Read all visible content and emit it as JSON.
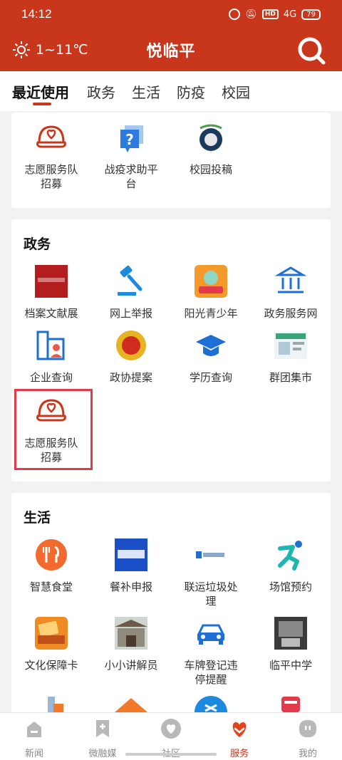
{
  "status_bar": {
    "time": "14:12",
    "network": "4G",
    "hd": "HD",
    "battery": "79"
  },
  "header": {
    "weather": "1~11℃",
    "title": "悦临平"
  },
  "tabs": [
    "最近使用",
    "政务",
    "生活",
    "防疫",
    "校园"
  ],
  "recent": {
    "items": [
      {
        "label": "志愿服务队招募",
        "icon": "volunteer-cap-icon"
      },
      {
        "label": "战疫求助平台",
        "icon": "help-question-icon"
      },
      {
        "label": "校园投稿",
        "icon": "campus-logo-icon"
      }
    ]
  },
  "government": {
    "title": "政务",
    "items": [
      {
        "label": "档案文献展",
        "icon": "archive-exhibit-icon"
      },
      {
        "label": "网上举报",
        "icon": "gavel-icon"
      },
      {
        "label": "阳光青少年",
        "icon": "youth-icon"
      },
      {
        "label": "政务服务网",
        "icon": "building-icon"
      },
      {
        "label": "企业查询",
        "icon": "enterprise-search-icon"
      },
      {
        "label": "政协提案",
        "icon": "emblem-icon"
      },
      {
        "label": "学历查询",
        "icon": "graduation-cap-icon"
      },
      {
        "label": "群团集市",
        "icon": "market-icon"
      },
      {
        "label": "志愿服务队招募",
        "icon": "volunteer-cap-icon"
      }
    ]
  },
  "life": {
    "title": "生活",
    "items": [
      {
        "label": "智慧食堂",
        "icon": "canteen-icon"
      },
      {
        "label": "餐补申报",
        "icon": "meal-subsidy-icon"
      },
      {
        "label": "联运垃圾处理",
        "icon": "garbage-icon"
      },
      {
        "label": "场馆预约",
        "icon": "runner-icon"
      },
      {
        "label": "文化保障卡",
        "icon": "culture-card-icon"
      },
      {
        "label": "小小讲解员",
        "icon": "guide-photo-icon"
      },
      {
        "label": "车牌登记违停提醒",
        "icon": "car-icon"
      },
      {
        "label": "临平中学",
        "icon": "school-photo-icon"
      }
    ]
  },
  "bottom_nav": [
    {
      "label": "新闻",
      "icon": "news-icon"
    },
    {
      "label": "微融媒",
      "icon": "media-icon"
    },
    {
      "label": "社区",
      "icon": "community-icon"
    },
    {
      "label": "服务",
      "icon": "service-heart-icon"
    },
    {
      "label": "我的",
      "icon": "profile-icon"
    }
  ],
  "colors": {
    "brand": "#c8361c",
    "highlight": "#e23a4a"
  }
}
